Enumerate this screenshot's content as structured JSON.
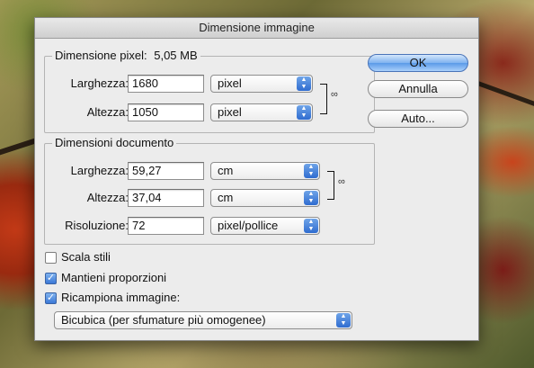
{
  "dialog": {
    "title": "Dimensione immagine"
  },
  "pixel_dims": {
    "title": "Dimensione pixel:",
    "size": "5,05 MB",
    "width_label": "Larghezza:",
    "width_value": "1680",
    "width_unit": "pixel",
    "height_label": "Altezza:",
    "height_value": "1050",
    "height_unit": "pixel"
  },
  "doc_dims": {
    "title": "Dimensioni documento",
    "width_label": "Larghezza:",
    "width_value": "59,27",
    "width_unit": "cm",
    "height_label": "Altezza:",
    "height_value": "37,04",
    "height_unit": "cm",
    "resolution_label": "Risoluzione:",
    "resolution_value": "72",
    "resolution_unit": "pixel/pollice"
  },
  "buttons": {
    "ok": "OK",
    "cancel": "Annulla",
    "auto": "Auto..."
  },
  "options": {
    "scale_styles": {
      "label": "Scala stili",
      "checked": false
    },
    "constrain": {
      "label": "Mantieni proporzioni",
      "checked": true
    },
    "resample": {
      "label": "Ricampiona immagine:",
      "checked": true
    },
    "method": "Bicubica (per sfumature più omogenee)"
  },
  "icons": {
    "link": "link-icon",
    "popup_arrows": "updown-arrows-icon",
    "check": "checkmark-icon"
  },
  "colors": {
    "default_button": "#5a9ae8",
    "popup_arrow": "#2f6cd0",
    "dialog_bg": "#ececec"
  }
}
